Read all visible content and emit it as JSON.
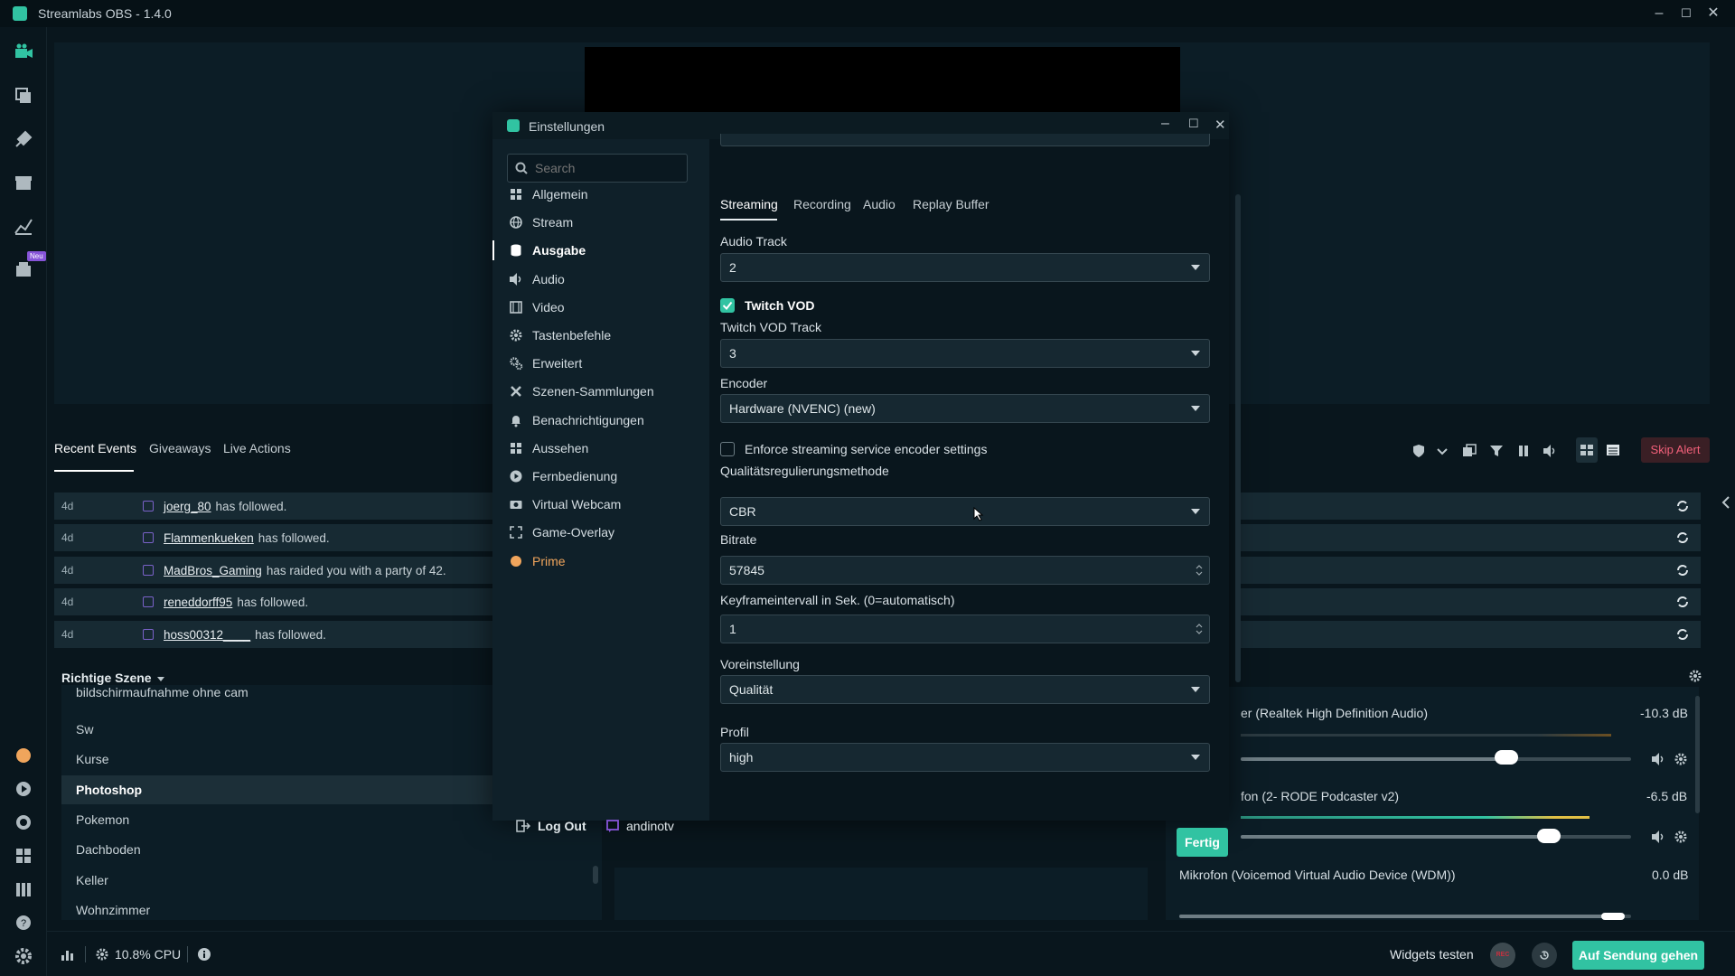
{
  "window": {
    "title": "Streamlabs OBS - 1.4.0",
    "rail_badge": "Neu"
  },
  "events": {
    "tabs": [
      "Recent Events",
      "Giveaways",
      "Live Actions"
    ],
    "skip_alert": "Skip Alert",
    "rows": [
      {
        "age": "4d",
        "user": "joerg_80",
        "msg": "has followed."
      },
      {
        "age": "4d",
        "user": "Flammenkueken",
        "msg": "has followed."
      },
      {
        "age": "4d",
        "user": "MadBros_Gaming",
        "msg": "has raided you with a party of 42."
      },
      {
        "age": "4d",
        "user": "reneddorff95",
        "msg": "has followed."
      },
      {
        "age": "4d",
        "user": "hoss00312____",
        "msg": "has followed."
      }
    ]
  },
  "scenes": {
    "header": "Richtige Szene",
    "items": [
      "bildschirmaufnahme ohne cam",
      "Sw",
      "Kurse",
      "Photoshop",
      "Pokemon",
      "Dachboden",
      "Keller",
      "Wohnzimmer"
    ],
    "active_index": 3
  },
  "mixer": {
    "channels": [
      {
        "name": "er (Realtek High Definition Audio)",
        "db": "-10.3 dB",
        "level": 0.68
      },
      {
        "name": "fon (2- RODE Podcaster v2)",
        "db": "-6.5 dB",
        "level": 0.79
      },
      {
        "name": "Mikrofon (Voicemod Virtual Audio Device (WDM))",
        "db": "0.0 dB",
        "level": 0.96
      }
    ]
  },
  "bottom": {
    "cpu": "10.8% CPU",
    "widgets_test": "Widgets testen",
    "rec": "REC",
    "go_live": "Auf Sendung gehen"
  },
  "settings": {
    "title": "Einstellungen",
    "search_placeholder": "Search",
    "nav": [
      {
        "label": "Allgemein",
        "icon": "grid-icon"
      },
      {
        "label": "Stream",
        "icon": "globe-icon"
      },
      {
        "label": "Ausgabe",
        "icon": "database-icon"
      },
      {
        "label": "Audio",
        "icon": "speaker-icon"
      },
      {
        "label": "Video",
        "icon": "film-icon"
      },
      {
        "label": "Tastenbefehle",
        "icon": "gear-icon"
      },
      {
        "label": "Erweitert",
        "icon": "gears-icon"
      },
      {
        "label": "Szenen-Sammlungen",
        "icon": "tools-icon"
      },
      {
        "label": "Benachrichtigungen",
        "icon": "bell-icon"
      },
      {
        "label": "Aussehen",
        "icon": "grid-icon"
      },
      {
        "label": "Fernbedienung",
        "icon": "play-circle-icon"
      },
      {
        "label": "Virtual Webcam",
        "icon": "camera-icon"
      },
      {
        "label": "Game-Overlay",
        "icon": "expand-icon"
      },
      {
        "label": "Prime",
        "icon": "prime-icon"
      }
    ],
    "active_nav": "Ausgabe",
    "prime_color": "#f0a55c",
    "logout": "Log Out",
    "username": "andinotv",
    "tabs": [
      "Streaming",
      "Recording",
      "Audio",
      "Replay Buffer"
    ],
    "active_tab": "Streaming",
    "audio_track_label": "Audio Track",
    "audio_track_value": "2",
    "twitch_vod_label": "Twitch VOD",
    "twitch_vod_checked": true,
    "twitch_vod_track_label": "Twitch VOD Track",
    "twitch_vod_track_value": "3",
    "encoder_label": "Encoder",
    "encoder_value": "Hardware (NVENC) (new)",
    "enforce_label": "Enforce streaming service encoder settings",
    "enforce_checked": false,
    "rate_control_label": "Qualitätsregulierungsmethode",
    "rate_control_value": "CBR",
    "bitrate_label": "Bitrate",
    "bitrate_value": "57845",
    "keyframe_label": "Keyframeintervall in Sek. (0=automatisch)",
    "keyframe_value": "1",
    "preset_label": "Voreinstellung",
    "preset_value": "Qualität",
    "profile_label": "Profil",
    "profile_value": "high",
    "done_button": "Fertig",
    "accent": "#31c3a2"
  }
}
